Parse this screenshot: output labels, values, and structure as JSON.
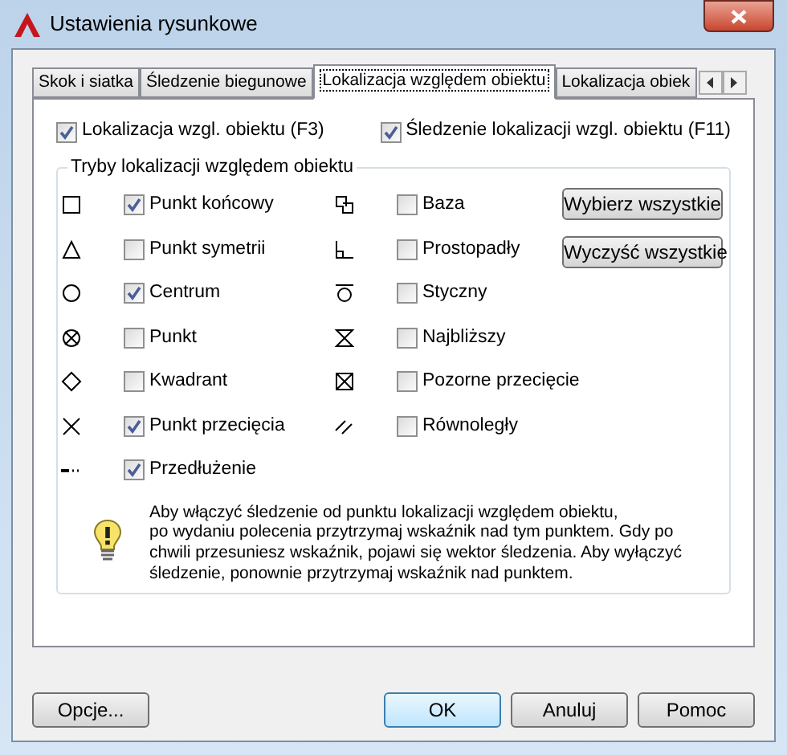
{
  "window": {
    "title": "Ustawienia rysunkowe"
  },
  "tabs": [
    {
      "label": "Skok i siatka",
      "selected": false
    },
    {
      "label": "Śledzenie biegunowe",
      "selected": false
    },
    {
      "label": "Lokalizacja względem obiektu",
      "selected": true
    },
    {
      "label": "Lokalizacja obiek",
      "selected": false
    }
  ],
  "options": [
    {
      "label": "Lokalizacja wzgl. obiektu (F3)",
      "checked": true
    },
    {
      "label": "Śledzenie lokalizacji wzgl. obiektu (F11)",
      "checked": true
    }
  ],
  "group": {
    "title": "Tryby lokalizacji względem obiektu",
    "columns": [
      {
        "modes": [
          {
            "label": "Punkt końcowy",
            "checked": true
          },
          {
            "label": "Punkt symetrii",
            "checked": false
          },
          {
            "label": "Centrum",
            "checked": true
          },
          {
            "label": "Punkt",
            "checked": false
          },
          {
            "label": "Kwadrant",
            "checked": false
          },
          {
            "label": "Punkt przecięcia",
            "checked": true
          },
          {
            "label": "Przedłużenie",
            "checked": true
          }
        ]
      },
      {
        "modes": [
          {
            "label": "Baza",
            "checked": false
          },
          {
            "label": "Prostopadły",
            "checked": false
          },
          {
            "label": "Styczny",
            "checked": false
          },
          {
            "label": "Najbliższy",
            "checked": false
          },
          {
            "label": "Pozorne przecięcie",
            "checked": false
          },
          {
            "label": "Równoległy",
            "checked": false
          }
        ]
      }
    ],
    "buttons": [
      "Wybierz wszystkie",
      "Wyczyść wszystkie"
    ],
    "info": "Aby włączyć śledzenie od punktu lokalizacji względem obiektu,\npo wydaniu polecenia przytrzymaj wskaźnik nad tym punktem. Gdy po\nchwili przesuniesz wskaźnik, pojawi się wektor śledzenia. Aby wyłączyć\nśledzenie, ponownie przytrzymaj wskaźnik nad punktem."
  },
  "footer": {
    "left_button": "Opcje...",
    "buttons": [
      "OK",
      "Anuluj",
      "Pomoc"
    ]
  }
}
